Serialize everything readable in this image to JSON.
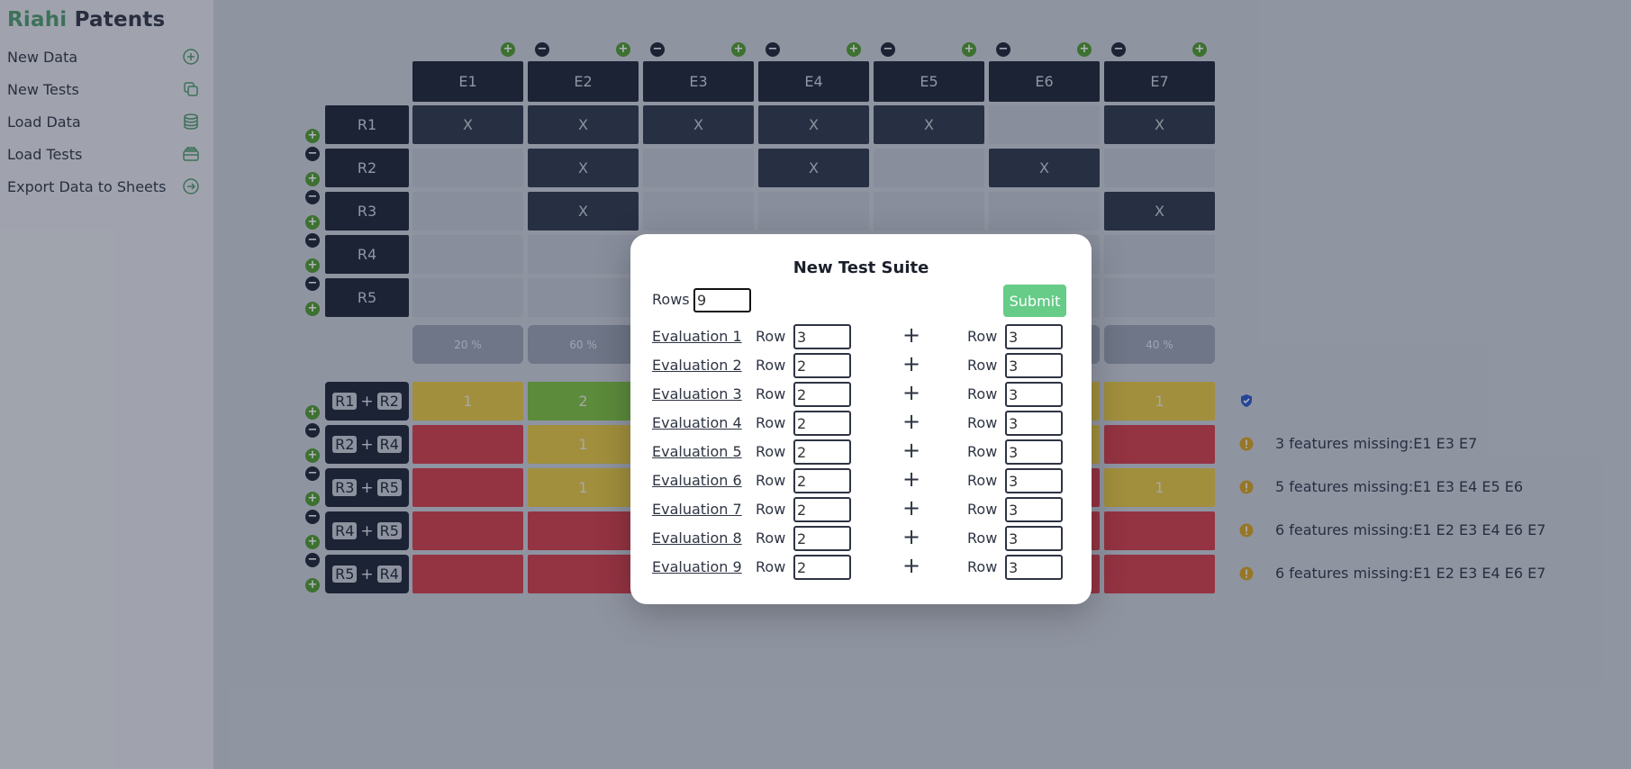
{
  "brand": {
    "part1": "Riahi",
    "part2": "Patents"
  },
  "sidebar": {
    "items": [
      {
        "label": "New Data",
        "icon": "plus-circle-icon"
      },
      {
        "label": "New Tests",
        "icon": "copy-icon"
      },
      {
        "label": "Load Data",
        "icon": "database-icon"
      },
      {
        "label": "Load Tests",
        "icon": "archive-icon"
      },
      {
        "label": "Export Data to Sheets",
        "icon": "arrow-circle-icon"
      }
    ]
  },
  "grid": {
    "columns": [
      "E1",
      "E2",
      "E3",
      "E4",
      "E5",
      "E6",
      "E7"
    ],
    "rows": [
      "R1",
      "R2",
      "R3",
      "R4",
      "R5"
    ],
    "cell_mark": "X",
    "cells": [
      [
        1,
        1,
        1,
        1,
        1,
        0,
        1
      ],
      [
        0,
        1,
        0,
        1,
        0,
        1,
        0
      ],
      [
        0,
        1,
        0,
        0,
        0,
        0,
        1
      ],
      [
        0,
        0,
        0,
        0,
        0,
        0,
        0
      ],
      [
        0,
        0,
        0,
        0,
        0,
        0,
        0
      ]
    ],
    "percentages": [
      "20 %",
      "60 %",
      "",
      "",
      "",
      "",
      "40 %"
    ]
  },
  "tests": {
    "combos": [
      {
        "a": "R1",
        "b": "R2",
        "status": "ok",
        "message": ""
      },
      {
        "a": "R2",
        "b": "R4",
        "status": "warning",
        "message": "3 features missing:E1 E3 E7"
      },
      {
        "a": "R3",
        "b": "R5",
        "status": "warning",
        "message": "5 features missing:E1 E3 E4 E5 E6"
      },
      {
        "a": "R4",
        "b": "R5",
        "status": "warning",
        "message": "6 features missing:E1 E2 E3 E4 E6 E7"
      },
      {
        "a": "R5",
        "b": "R4",
        "status": "warning",
        "message": "6 features missing:E1 E2 E3 E4 E6 E7"
      }
    ],
    "plus_sign": "+",
    "results_first": [
      [
        "1",
        "2"
      ],
      [
        "",
        "1"
      ],
      [
        "",
        "1"
      ],
      [
        "",
        ""
      ],
      [
        "",
        ""
      ]
    ],
    "results_first_colors": [
      [
        "yellow",
        "green"
      ],
      [
        "red",
        "yellow"
      ],
      [
        "red",
        "yellow"
      ],
      [
        "red",
        "red"
      ],
      [
        "red",
        "red"
      ]
    ],
    "results_last": [
      "1",
      "",
      "1",
      "",
      ""
    ],
    "results_last_colors": [
      "yellow",
      "red",
      "yellow",
      "red",
      "red"
    ],
    "partial_e6_colors": [
      "yellow",
      "yellow",
      "red",
      "red",
      "red"
    ]
  },
  "modal": {
    "title": "New Test Suite",
    "rows_label": "Rows",
    "rows_value": "9",
    "submit_label": "Submit",
    "row_label": "Row",
    "plus": "+",
    "evaluations": [
      {
        "label": "Evaluation 1",
        "row_a": "3",
        "row_b": "3"
      },
      {
        "label": "Evaluation 2",
        "row_a": "2",
        "row_b": "3"
      },
      {
        "label": "Evaluation 3",
        "row_a": "2",
        "row_b": "3"
      },
      {
        "label": "Evaluation 4",
        "row_a": "2",
        "row_b": "3"
      },
      {
        "label": "Evaluation 5",
        "row_a": "2",
        "row_b": "3"
      },
      {
        "label": "Evaluation 6",
        "row_a": "2",
        "row_b": "3"
      },
      {
        "label": "Evaluation 7",
        "row_a": "2",
        "row_b": "3"
      },
      {
        "label": "Evaluation 8",
        "row_a": "2",
        "row_b": "3"
      },
      {
        "label": "Evaluation 9",
        "row_a": "2",
        "row_b": "3"
      }
    ]
  },
  "colors": {
    "accent": "#4f9a6a",
    "dark": "#1c2231",
    "ok": "#2a56c6",
    "warning": "#d8a320",
    "submit": "#66cc88"
  }
}
